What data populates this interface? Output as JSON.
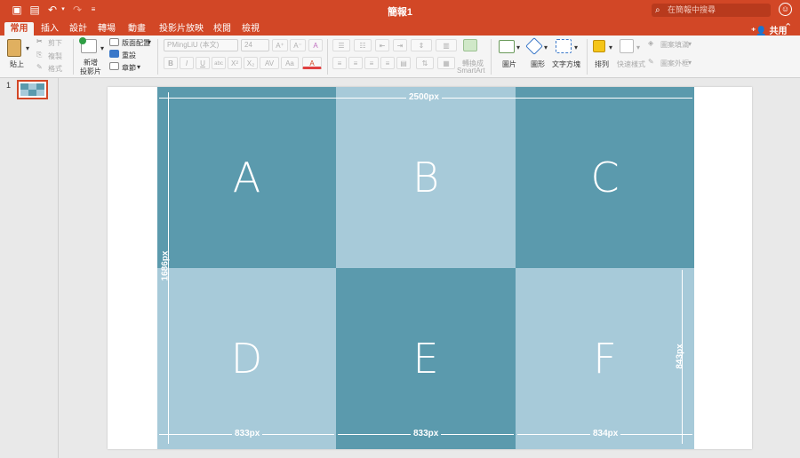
{
  "titlebar": {
    "doc_title": "簡報1",
    "search_placeholder": "在簡報中搜尋"
  },
  "tabs": [
    {
      "label": "常用",
      "active": true
    },
    {
      "label": "插入"
    },
    {
      "label": "設計"
    },
    {
      "label": "轉場"
    },
    {
      "label": "動畫"
    },
    {
      "label": "投影片放映"
    },
    {
      "label": "校閱"
    },
    {
      "label": "檢視"
    }
  ],
  "share_label": "共用",
  "ribbon": {
    "paste": "貼上",
    "cut": "剪下",
    "copy": "複製",
    "format": "格式",
    "new_slide_line1": "新增",
    "new_slide_line2": "投影片",
    "layout": "版面配置",
    "reset": "重設",
    "section": "章節",
    "font_name": "PMingLiU (本文)",
    "font_size": "24",
    "convert_line1": "轉換成",
    "convert_line2": "SmartArt",
    "picture": "圖片",
    "shape": "圖形",
    "textbox": "文字方塊",
    "arrange": "排列",
    "quick_styles": "快速樣式",
    "shape_fill": "圖案填滿",
    "shape_outline": "圖案外框"
  },
  "thumbnails": {
    "slide_number": "1"
  },
  "slide": {
    "cells": [
      {
        "label": "A",
        "tone": "dark"
      },
      {
        "label": "B",
        "tone": "light"
      },
      {
        "label": "C",
        "tone": "dark"
      },
      {
        "label": "D",
        "tone": "light"
      },
      {
        "label": "E",
        "tone": "dark"
      },
      {
        "label": "F",
        "tone": "light"
      }
    ],
    "dim_width_total": "2500px",
    "dim_height_total": "1686px",
    "dim_col1": "833px",
    "dim_col2": "833px",
    "dim_col3": "834px",
    "dim_row2": "843px"
  },
  "colors": {
    "accent": "#d24726",
    "dark_cell": "#5b9aad",
    "light_cell": "#a7cad9"
  }
}
